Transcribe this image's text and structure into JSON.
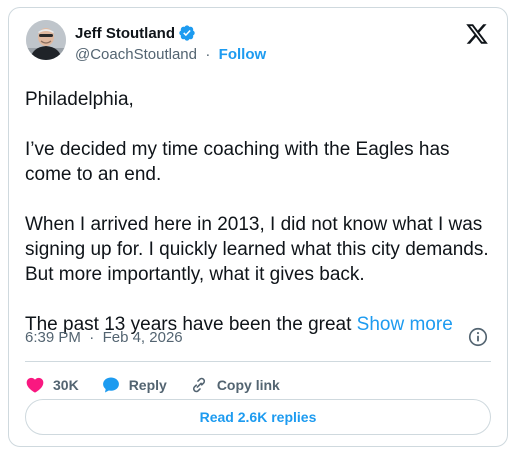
{
  "author": {
    "name": "Jeff Stoutland",
    "handle": "@CoachStoutland",
    "separator": "·",
    "follow_label": "Follow",
    "verified_color": "#1d9bf0"
  },
  "tweet": {
    "paragraphs": [
      "Philadelphia,",
      "I’ve decided my time coaching with the Eagles has come to an end.",
      "When I arrived here in 2013, I did not know what I was signing up for. I quickly learned what this city demands. But more importantly, what it gives back.",
      "The past 13 years have been the great"
    ],
    "show_more_label": "Show more"
  },
  "meta": {
    "time": "6:39 PM",
    "separator": "·",
    "date": "Feb 4, 2026"
  },
  "actions": {
    "like_count": "30K",
    "reply_label": "Reply",
    "copy_label": "Copy link",
    "like_color": "#f91880",
    "reply_color": "#1d9bf0"
  },
  "replies_button": {
    "label": "Read 2.6K replies"
  },
  "icons": {
    "logo": "x-logo-icon",
    "info": "info-icon",
    "like": "heart-icon",
    "reply": "speech-bubble-icon",
    "copy": "link-icon",
    "verified": "verified-badge-icon"
  }
}
